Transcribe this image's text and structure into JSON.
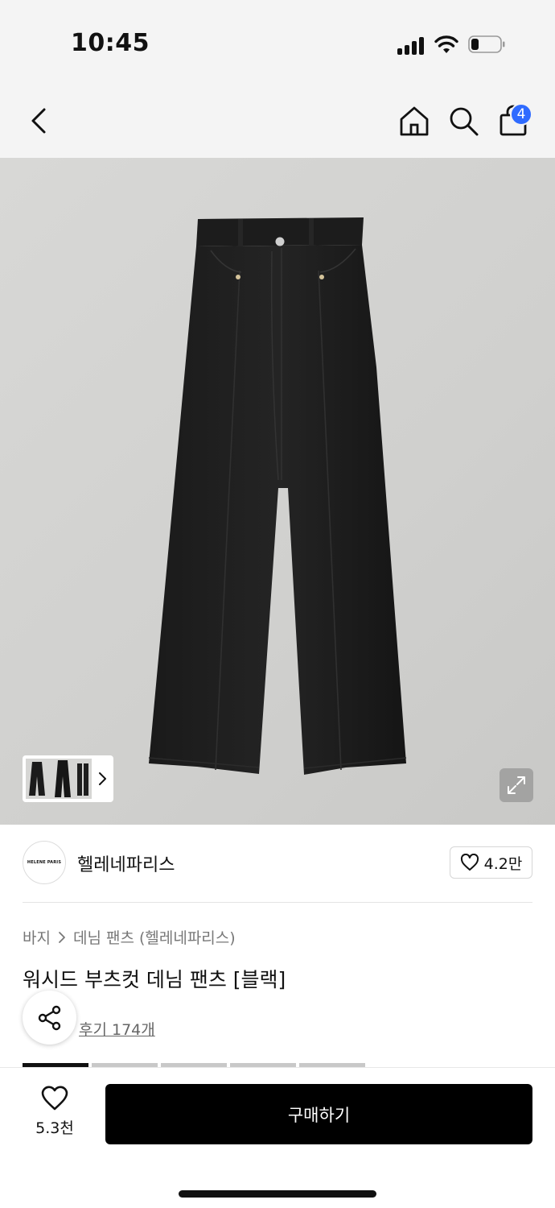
{
  "status_bar": {
    "time": "10:45"
  },
  "nav": {
    "icons": [
      "back-chevron-icon",
      "home-icon",
      "search-icon",
      "shopping-bag-icon"
    ],
    "cart_badge": "4",
    "accent_color": "#2f6bff"
  },
  "gallery": {
    "thumbnail_icon": "chevron-right-icon",
    "expand_icon": "expand-icon"
  },
  "brand": {
    "logo_text": "HELENE PARIS",
    "name": "헬레네파리스",
    "like_count": "4.2만"
  },
  "product": {
    "breadcrumb": [
      "바지",
      "데님 팬츠 (헬레네파리스)"
    ],
    "title": "워시드 부츠컷 데님 팬츠 [블랙]",
    "review_link": "후기 174개"
  },
  "bottom_bar": {
    "wish_count": "5.3천",
    "buy_label": "구매하기"
  }
}
